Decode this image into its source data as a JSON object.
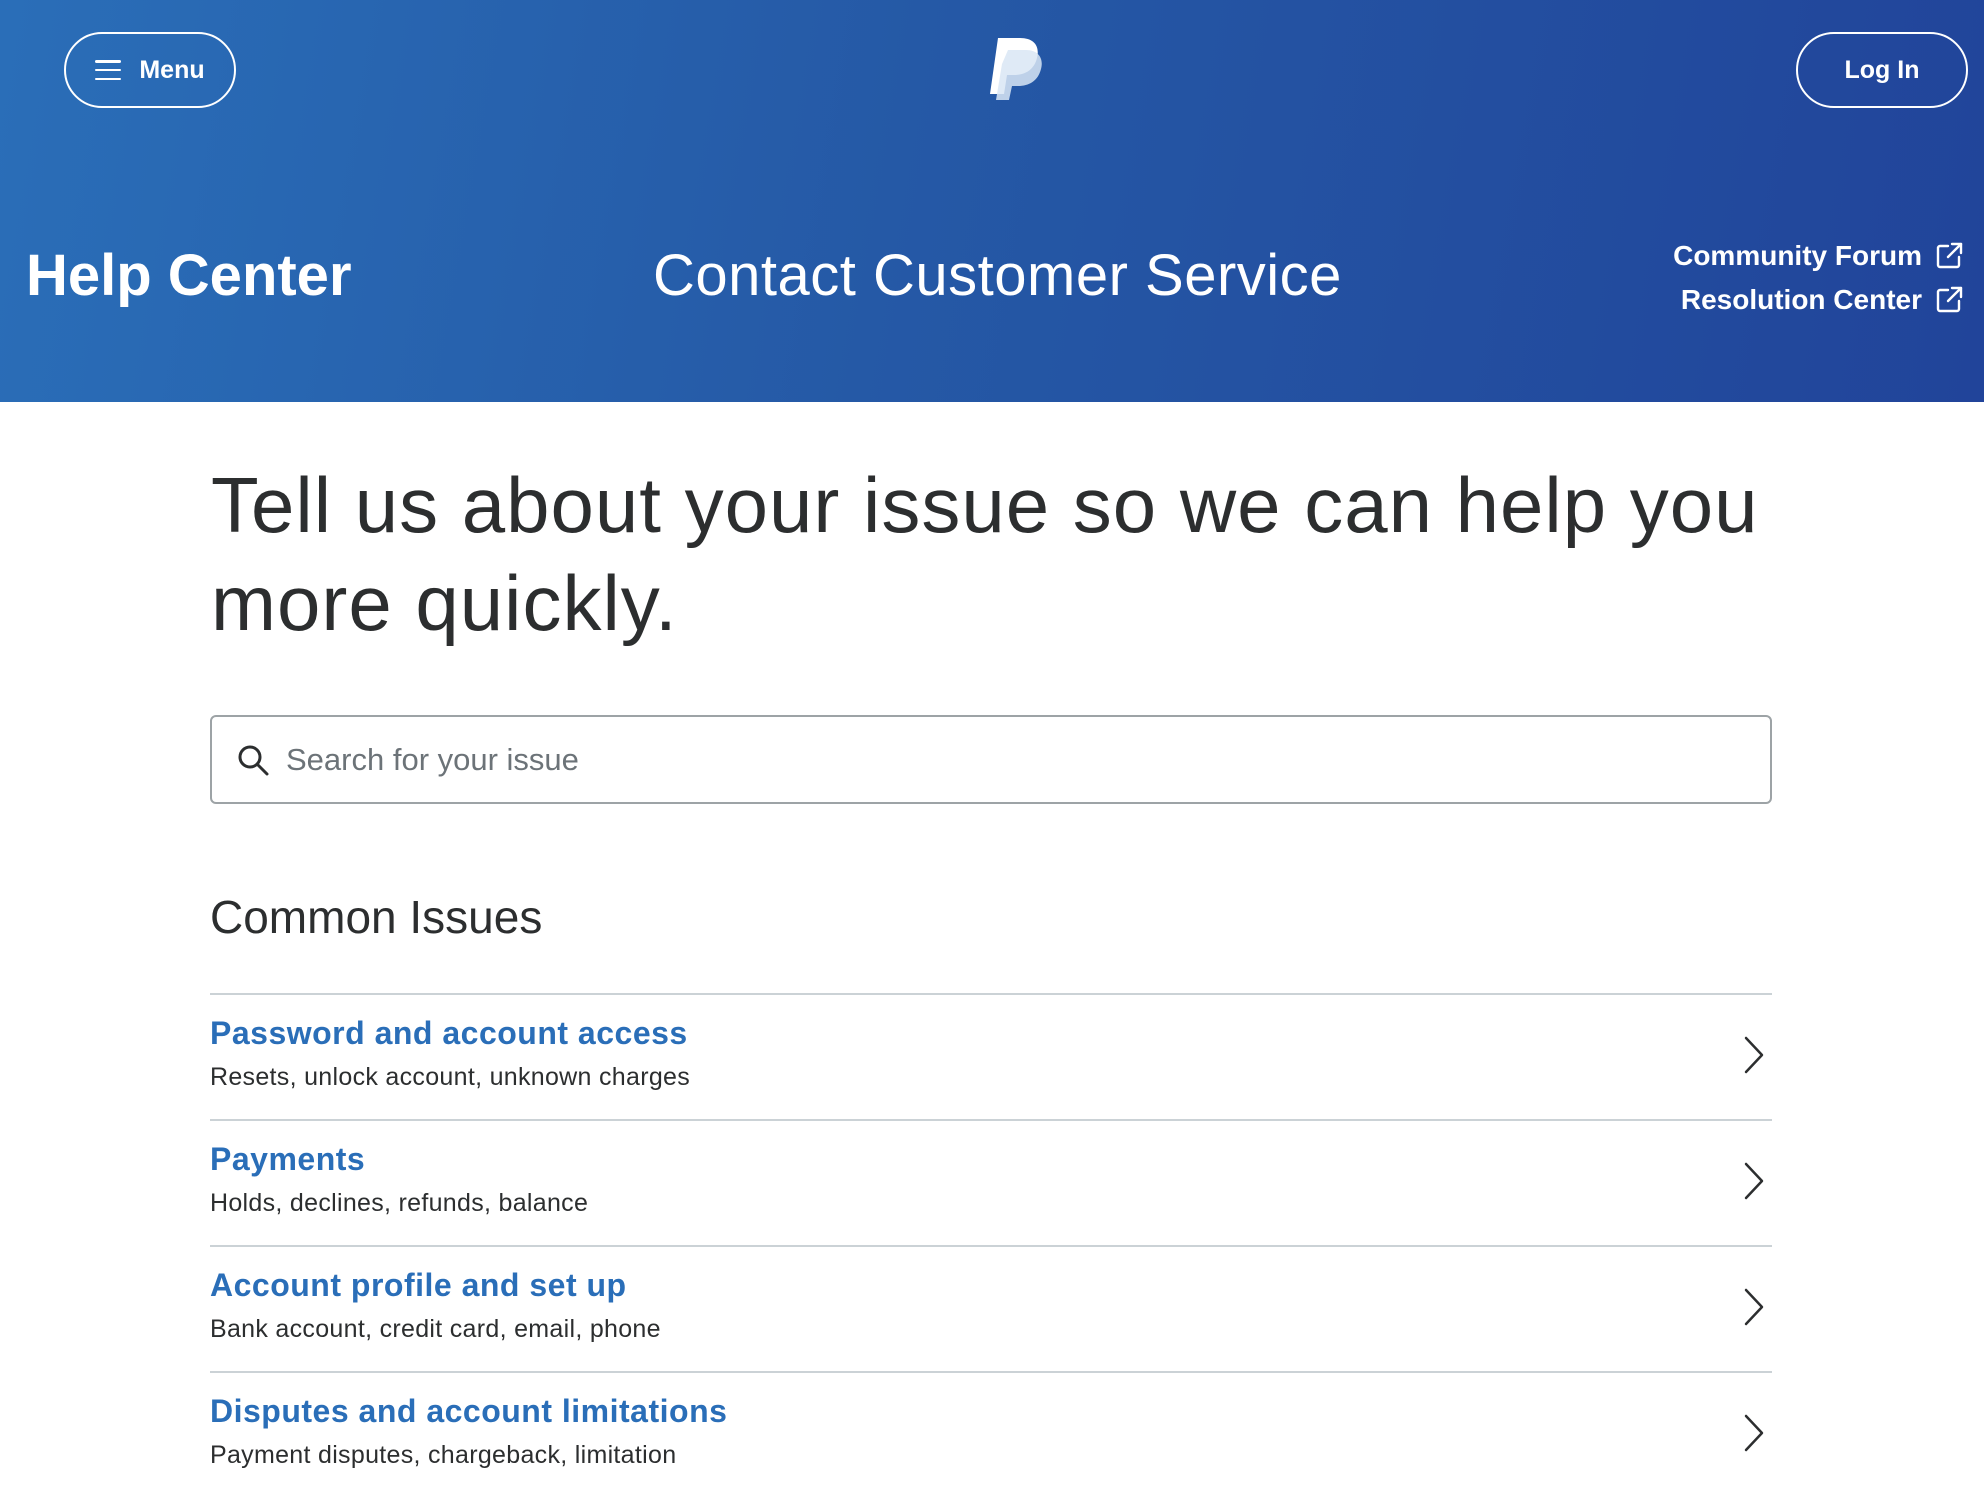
{
  "header": {
    "menu_label": "Menu",
    "login_label": "Log In",
    "logo_name": "paypal-logo"
  },
  "hero": {
    "help_center": "Help Center",
    "title": "Contact Customer Service",
    "links": [
      {
        "label": "Community Forum",
        "icon": "external-link-icon"
      },
      {
        "label": "Resolution Center",
        "icon": "external-link-icon"
      }
    ]
  },
  "main": {
    "headline": "Tell us about your issue so we can help you more quickly.",
    "search": {
      "placeholder": "Search for your issue",
      "value": ""
    },
    "common_issues_title": "Common Issues",
    "issues": [
      {
        "title": "Password and account access",
        "desc": "Resets, unlock account, unknown charges"
      },
      {
        "title": "Payments",
        "desc": "Holds, declines, refunds, balance"
      },
      {
        "title": "Account profile and set up",
        "desc": "Bank account, credit card, email, phone"
      },
      {
        "title": "Disputes and account limitations",
        "desc": "Payment disputes, chargeback, limitation"
      }
    ]
  },
  "colors": {
    "hero_start": "#2a6eb8",
    "hero_end": "#21449a",
    "link_blue": "#2a6eb8",
    "text_dark": "#2c2e2f",
    "divider": "#cbd2d6"
  }
}
